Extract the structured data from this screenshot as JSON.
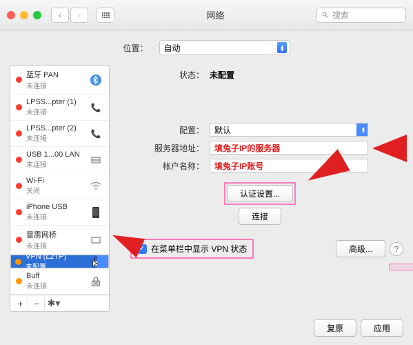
{
  "window": {
    "title": "网络"
  },
  "search": {
    "placeholder": "搜索"
  },
  "location": {
    "label": "位置：",
    "value": "自动"
  },
  "sidebar": {
    "items": [
      {
        "name": "蓝牙 PAN",
        "status": "未连接",
        "dot": "red"
      },
      {
        "name": "LPSS...pter (1)",
        "status": "未连接",
        "dot": "red"
      },
      {
        "name": "LPSS...pter (2)",
        "status": "未连接",
        "dot": "red"
      },
      {
        "name": "USB 1...00 LAN",
        "status": "未连接",
        "dot": "red"
      },
      {
        "name": "Wi-Fi",
        "status": "关闭",
        "dot": "red"
      },
      {
        "name": "iPhone USB",
        "status": "未连接",
        "dot": "red"
      },
      {
        "name": "雷雳网桥",
        "status": "未连接",
        "dot": "red"
      },
      {
        "name": "VPN (L2TP)",
        "status": "未配置",
        "dot": "or"
      },
      {
        "name": "Buff",
        "status": "未连接",
        "dot": "or"
      }
    ]
  },
  "detail": {
    "status_label": "状态：",
    "status_value": "未配置",
    "config_label": "配置：",
    "config_value": "默认",
    "server_label": "服务器地址：",
    "server_value": "填兔子IP的服务器",
    "account_label": "帐户名称：",
    "account_value": "填兔子IP账号",
    "auth_button": "认证设置...",
    "connect_button": "连接",
    "show_vpn_label": "在菜单栏中显示 VPN 状态",
    "advanced_button": "高级...",
    "revert_button": "复原",
    "apply_button": "应用"
  }
}
